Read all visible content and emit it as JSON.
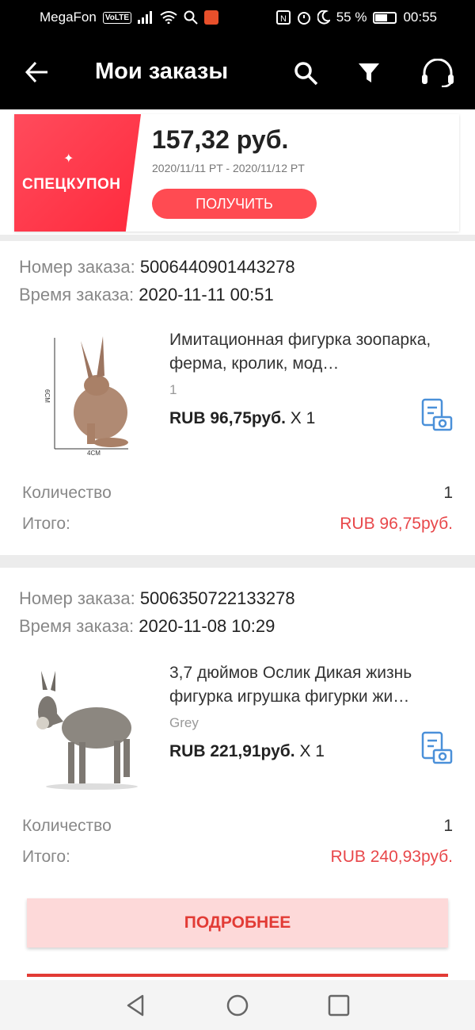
{
  "status": {
    "carrier": "MegaFon",
    "volte": "VoLTE",
    "battery": "55 %",
    "time": "00:55"
  },
  "header": {
    "title": "Мои заказы"
  },
  "coupon": {
    "label": "СПЕЦКУПОН",
    "amount": "157,32 руб.",
    "dates": "2020/11/11 PT - 2020/11/12 PT",
    "button": "ПОЛУЧИТЬ"
  },
  "labels": {
    "order_number": "Номер заказа:",
    "order_time": "Время заказа:",
    "quantity": "Количество",
    "total": "Итого:",
    "more": "ПОДРОБНЕЕ"
  },
  "orders": [
    {
      "number": "5006440901443278",
      "time": "2020-11-11 00:51",
      "product": "Имитационная фигурка зоопарка, ферма, кролик, мод…",
      "variant": "1",
      "price": "RUB 96,75руб.",
      "qty_mult": "X 1",
      "quantity": "1",
      "total": "RUB 96,75руб.",
      "img_label_h": "6CM",
      "img_label_w": "4CM"
    },
    {
      "number": "5006350722133278",
      "time": "2020-11-08 10:29",
      "product": "3,7 дюймов Ослик Дикая жизнь фигурка игрушка фигурки жи…",
      "variant": "Grey",
      "price": "RUB 221,91руб.",
      "qty_mult": "X 1",
      "quantity": "1",
      "total": "RUB 240,93руб."
    }
  ]
}
